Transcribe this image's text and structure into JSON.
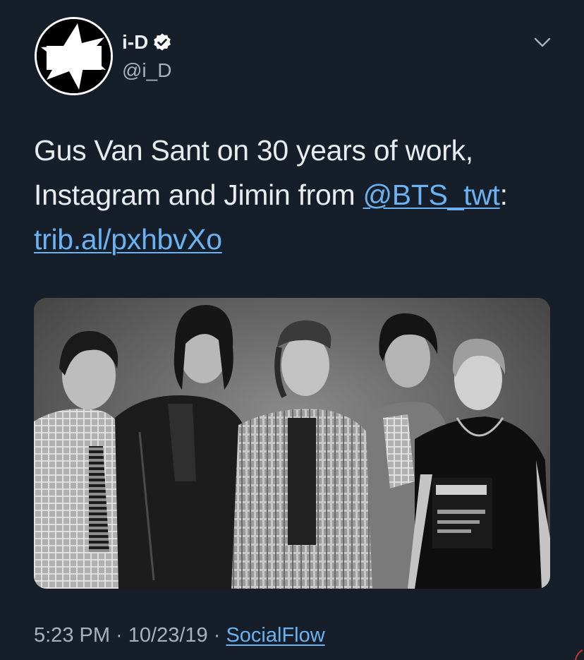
{
  "header": {
    "display_name": "i-D",
    "handle": "@i_D",
    "avatar_logo_text": "i-D",
    "verified": true
  },
  "tweet": {
    "text_part1": "Gus Van Sant on 30 years of work, Instagram and Jimin from ",
    "mention": "@BTS_twt",
    "text_part2": ":",
    "url": "trib.al/pxhbvXo"
  },
  "media": {
    "type": "photo",
    "description_shown": "black and white group photo of five young men"
  },
  "meta": {
    "time": "5:23 PM",
    "separator": " · ",
    "date": "10/23/19",
    "separator2": " · ",
    "source": "SocialFlow"
  },
  "colors": {
    "background": "#151e29",
    "link": "#6ab2f2",
    "text": "#e8ecef",
    "secondary": "#a8b2bc"
  },
  "icons": {
    "verified": "verified-badge-icon",
    "menu": "chevron-down-icon"
  }
}
